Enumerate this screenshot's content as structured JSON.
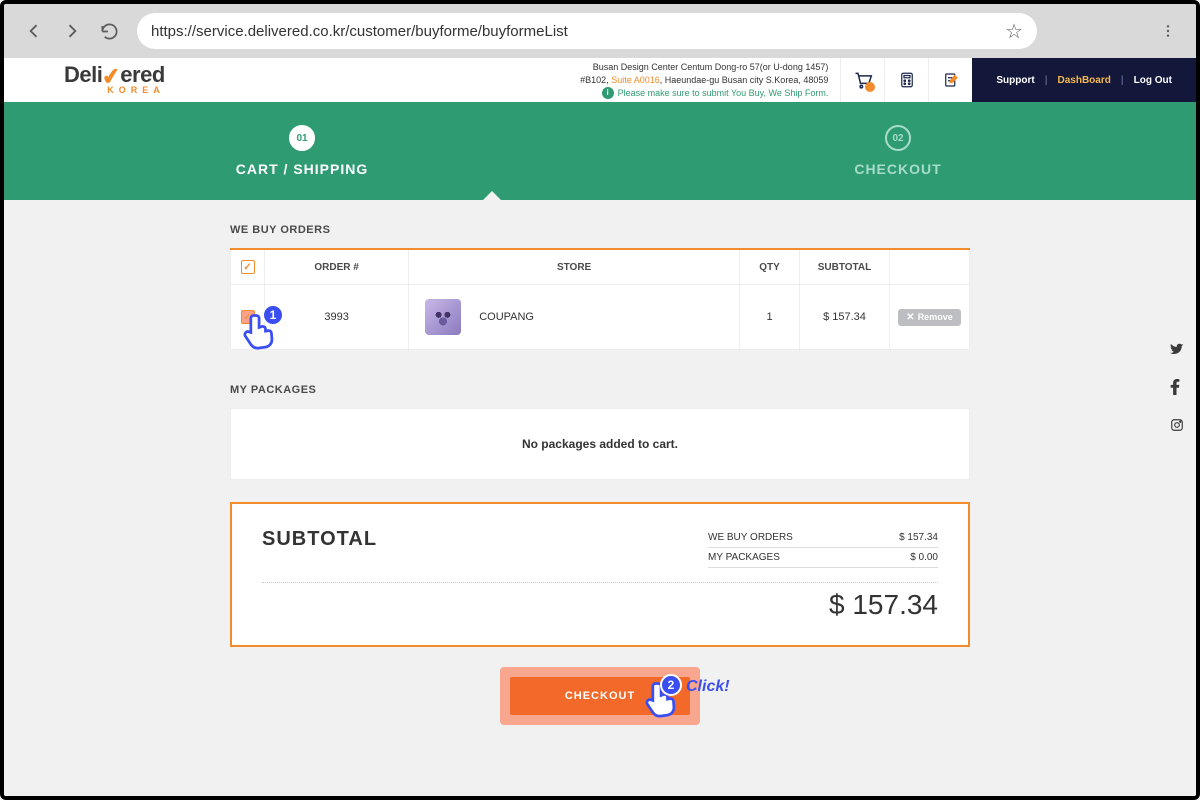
{
  "browser": {
    "url": "https://service.delivered.co.kr/customer/buyforme/buyformeList"
  },
  "logo": {
    "main_a": "Deli",
    "main_b": "ered",
    "sub": "KOREA"
  },
  "header": {
    "addr_line1": "Busan Design Center Centum Dong-ro 57(or U-dong 1457)",
    "addr_pre": "#B102, ",
    "addr_suite": "Suite A0016",
    "addr_post": ", Haeundae-gu Busan city S.Korea, 48059",
    "notice": "Please make sure to submit You Buy, We Ship Form.",
    "support": "Support",
    "dashboard": "DashBoard",
    "logout": "Log Out"
  },
  "steps": {
    "s1_num": "01",
    "s1_lbl": "CART / SHIPPING",
    "s2_num": "02",
    "s2_lbl": "CHECKOUT"
  },
  "webuy": {
    "title": "WE BUY ORDERS",
    "col_order": "ORDER #",
    "col_store": "STORE",
    "col_qty": "QTY",
    "col_sub": "SUBTOTAL",
    "row": {
      "order": "3993",
      "store": "COUPANG",
      "qty": "1",
      "sub": "$ 157.34",
      "remove": "Remove"
    }
  },
  "packages": {
    "title": "MY PACKAGES",
    "empty": "No packages added to cart."
  },
  "subtotal": {
    "title": "SUBTOTAL",
    "r1_l": "WE BUY ORDERS",
    "r1_v": "$ 157.34",
    "r2_l": "MY PACKAGES",
    "r2_v": "$ 0.00",
    "grand": "$ 157.34"
  },
  "checkout": {
    "btn": "CHECKOUT",
    "click_lbl": "Click!",
    "badge1": "1",
    "badge2": "2"
  }
}
